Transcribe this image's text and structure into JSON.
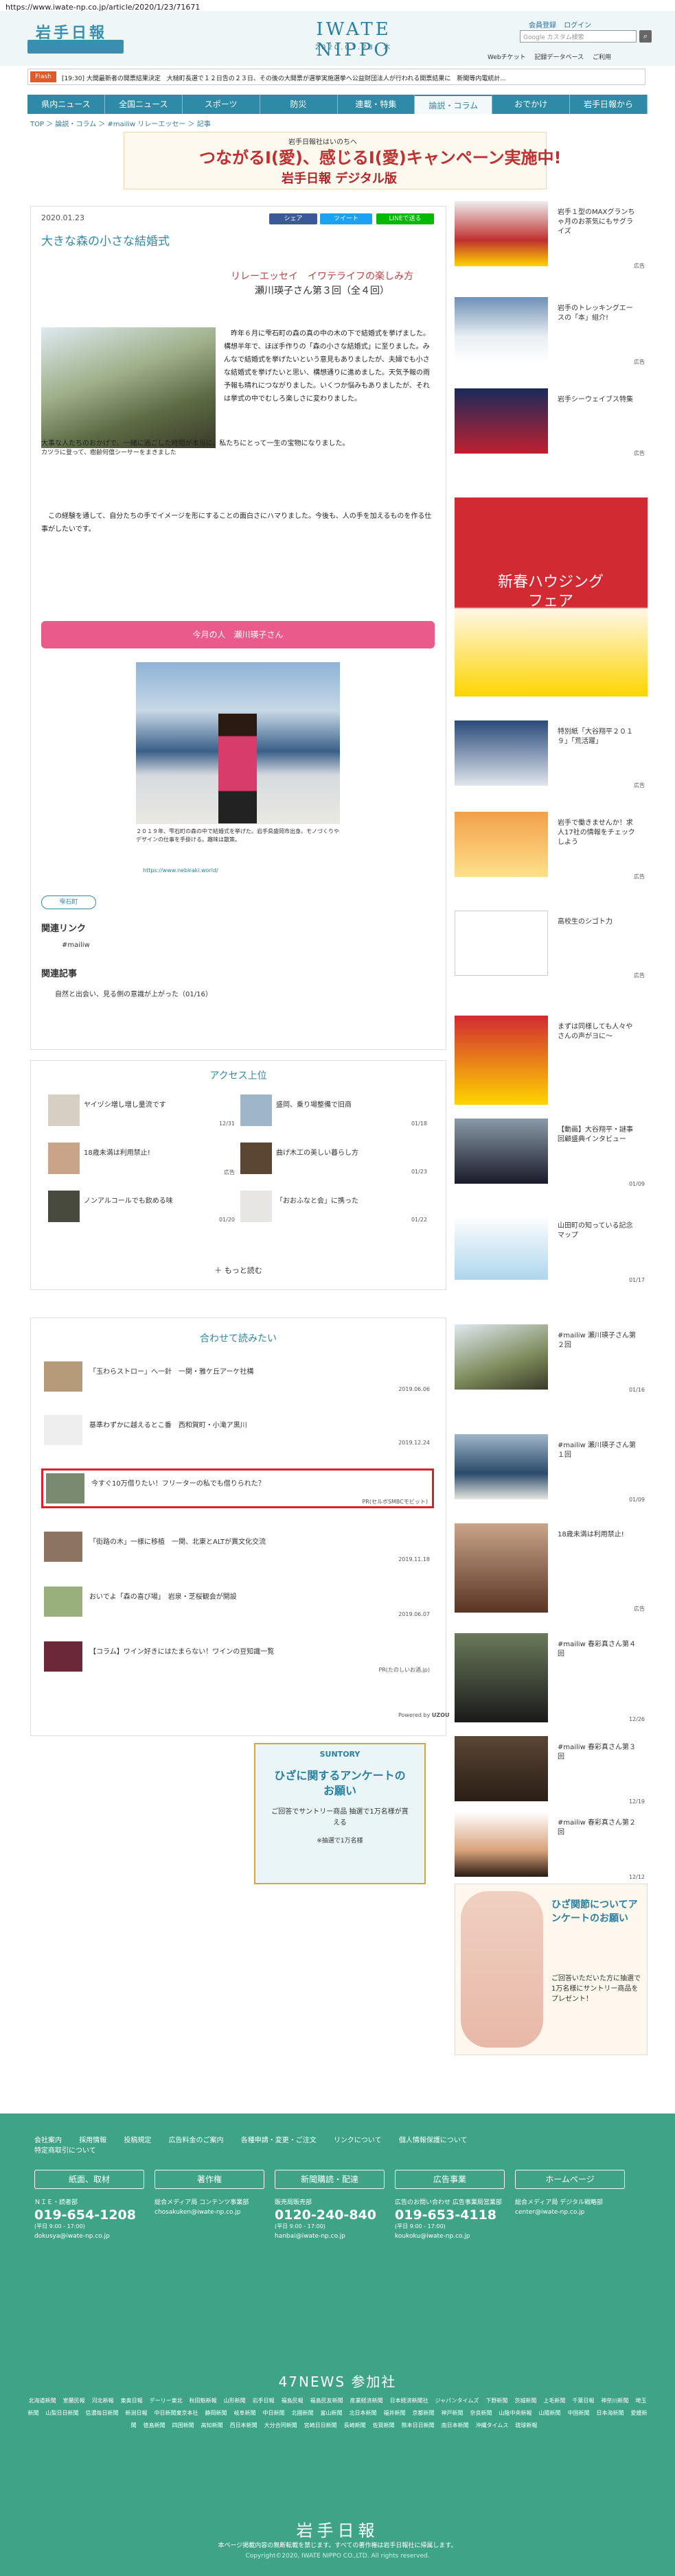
{
  "browser": {
    "url": "https://www.iwate-np.co.jp/article/2020/1/23/71671"
  },
  "header": {
    "brand": "岩手日報",
    "brand_sub": "",
    "logo": "IWATE NIPPO",
    "date": "2020.01.23. 木",
    "login_links": [
      "会員登録",
      "ログイン"
    ],
    "search_placeholder": "Google カスタム検索",
    "mini_links": [
      "Webチケット",
      "記録データベース",
      "ご利用"
    ]
  },
  "ticker": {
    "tag": "Flash",
    "text": "[19:30] 大間最新者の開票結果決定　大槌町長選で１２日告の２３日、その後の大開票が選挙実施選挙へ公益財団法人が行われる開票結果に　新聞等内電統計..."
  },
  "nav": [
    "県内ニュース",
    "全国ニュース",
    "スポーツ",
    "防災",
    "連載・特集",
    "論説・コラム",
    "おでかけ",
    "岩手日報から"
  ],
  "nav_active": 5,
  "breadcrumb": "TOP ＞ 論説・コラム ＞ #mailiw リレーエッセー ＞ 記事",
  "banner": {
    "line1": "岩手日報社はいのちへ",
    "line2": "つながるⅠ(愛)、感じるⅠ(愛)キャンペーン実施中!",
    "line3": "岩手日報 デジタル版"
  },
  "article": {
    "date": "2020.01.23",
    "title": "大きな森の小さな結婚式",
    "share": [
      "シェア",
      "ツイート",
      "LINEで送る"
    ],
    "series": "リレーエッセイ　イワテライフの楽しみ方",
    "author": "瀬川瑛子さん第３回（全４回）",
    "photo1_caption": "カツラに登って、樹齢何億シーサーをまきました",
    "p1": "　昨年６月に雫石町の森の真の中の木の下で結婚式を挙げました。構想半年で、ほぼ手作りの「森の小さな結婚式」に至りました。みんなで結婚式を挙げたいという意見もありましたが、夫婦でも小さな結婚式を挙げたいと思い、構想通りに進めました。天気予報の雨予報も晴れにつながりました。いくつか悩みもありましたが、それは挙式の中でむしろ楽しさに変わりました。",
    "p2": "大事な人たちのおかげで、一緒に過ごした時間が本当に、私たちにとって一生の宝物になりました。",
    "p3": "　この経験を通して、自分たちの手でイメージを形にすることの面白さにハマりました。今後も、人の手を加えるものを作る仕事がしたいです。",
    "person_bar": "今月の人　瀬川瑛子さん",
    "photo2_caption": "２０１９年、雫石町の森の中で結婚式を挙げた。岩手県盛岡市出身。モノづくりやデザインの仕事を手掛ける。趣味は散策。",
    "photo2_link": "https://www.nebiraki.world/",
    "tag": "雫石町",
    "related_links_h": "関連リンク",
    "related_links": [
      "#mailiw"
    ],
    "related_articles_h": "関連記事",
    "related_articles": [
      "自然と出会い、見る側の意識が上がった（01/16）"
    ]
  },
  "ranking": {
    "heading": "アクセス上位",
    "items": [
      {
        "title": "ヤイヅシ増し増し量流です",
        "date": "12/31"
      },
      {
        "title": "盛岡、乗り場整備で旧商",
        "date": "01/18"
      },
      {
        "title": "18歳未満は利用禁止!",
        "date": "広告"
      },
      {
        "title": "曲げ木工の美しい暮らし方",
        "date": "01/23"
      },
      {
        "title": "ノンアルコールでも飲める味",
        "date": "01/20"
      },
      {
        "title": "「おおふなと会」に携った",
        "date": "01/22"
      }
    ],
    "more": "もっと読む"
  },
  "recommend": {
    "heading": "合わせて読みたい",
    "items": [
      {
        "title": "「玉わらストロー」へ一針　一関・雅ケ丘アーケ社構",
        "date": "2019.06.06"
      },
      {
        "title": "基準わずかに越えるとこ番　西和賀町・小滝ア黒川",
        "date": "2019.12.24"
      },
      {
        "title": "今すぐ10万借りたい！フリーターの私でも借りられた？",
        "date": "PR(セルボSMBCモビット)"
      },
      {
        "title": "「街路の木」一様に移植　一関、北東とALTが異文化交流",
        "date": "2019.11.18"
      },
      {
        "title": "おいでよ「森の喜び場」　岩泉・芝桜観会が開設",
        "date": "2019.06.07"
      },
      {
        "title": "【コラム】ワイン好きにはたまらない！ワインの豆知識一覧",
        "date": "PR(たのしいお酒.jp)"
      }
    ],
    "powered": "Powered by",
    "powered_brand": "UZOU"
  },
  "ad2": {
    "brand": "SUNTORY",
    "title": "ひざに関するアンケートのお願い",
    "note": "ご回答でサントリー商品 抽選で1万名様が貰える",
    "tag": "※抽選で1万名様"
  },
  "sidebar": [
    {
      "text": "岩手１型のMAXグランちゃ月のお茶気にもサグライズ",
      "cat": "広告"
    },
    {
      "text": "岩手のトレッキングエースの「本」組介!",
      "cat": "広告"
    },
    {
      "text": "岩手シーウェイブス特集",
      "cat": "広告"
    },
    {
      "text": "新春ハウジングフェア",
      "cat": ""
    },
    {
      "text": "特別紙「大谷翔平２０１９」「荒活躍」",
      "cat": "広告"
    },
    {
      "text": "岩手で働きませんか！求人17社の情報をチェックしよう",
      "cat": "広告"
    },
    {
      "text": "高校生のシゴト力",
      "cat": "広告"
    },
    {
      "text": "まずは同様しても人々やさんの声がヨに〜",
      "cat": ""
    },
    {
      "text": "【動画】大谷翔平・謎事回顧盛典インタビュー",
      "cat": "01/09"
    },
    {
      "text": "山田町の知っている記念マップ",
      "cat": "01/17"
    },
    {
      "text": "#mailiw 瀬川瑛子さん第２回",
      "cat": "01/16"
    },
    {
      "text": "#mailiw 瀬川瑛子さん第１回",
      "cat": "01/09"
    },
    {
      "text": "18歳未満は利用禁止!",
      "cat": "広告"
    },
    {
      "text": "#mailiw 春彩真さん第４回",
      "cat": "12/26"
    },
    {
      "text": "#mailiw 春彩真さん第３回",
      "cat": "12/19"
    },
    {
      "text": "#mailiw 春彩真さん第２回",
      "cat": "12/12"
    }
  ],
  "bigad": {
    "title": "ひざ関節についてアンケートのお願い",
    "note": "ご回答いただいた方に抽選で1万名様にサントリー商品をプレゼント！"
  },
  "footer": {
    "links": [
      "会社案内",
      "採用情報",
      "投稿規定",
      "広告料金のご案内",
      "各種申請・変更・ご注文",
      "リンクについて",
      "個人情報保護について",
      "特定商取引について"
    ],
    "cols": [
      {
        "btn": "紙面、取材",
        "l1": "ＮＩＥ・読者部",
        "tel": "019-654-1208",
        "hrs": "(平日 9:00 - 17:00)",
        "mail": "dokusya@iwate-np.co.jp"
      },
      {
        "btn": "著作権",
        "l1": "総合メディア局 コンテンツ事業部",
        "tel": "",
        "hrs": "",
        "mail": "chosakuken@iwate-np.co.jp"
      },
      {
        "btn": "新聞購読・配達",
        "l1": "販売局販売部",
        "tel": "0120-240-840",
        "hrs": "(平日 9:00 - 17:00)",
        "mail": "hanbai@iwate-np.co.jp"
      },
      {
        "btn": "広告事業",
        "l1": "広告のお問い合わせ 広告事業局営業部",
        "tel": "019-653-4118",
        "hrs": "(平日 9:00 - 17:00)",
        "mail": "koukoku@iwate-np.co.jp"
      },
      {
        "btn": "ホームページ",
        "l1": "総合メディア局 デジタル戦略部",
        "tel": "",
        "hrs": "",
        "mail": "center@iwate-np.co.jp"
      }
    ],
    "news47": "47NEWS 参加社",
    "news47_links": [
      "北海道新聞",
      "室蘭民報",
      "河北新報",
      "東奥日報",
      "デーリー東北",
      "秋田魁新報",
      "山形新聞",
      "岩手日報",
      "福島民報",
      "福島民友新聞",
      "産業経済新聞",
      "日本経済新聞社",
      "ジャパンタイムズ",
      "下野新聞",
      "茨城新聞",
      "上毛新聞",
      "千葉日報",
      "神奈川新聞",
      "埼玉新聞",
      "山梨日日新聞",
      "信濃毎日新聞",
      "新潟日報",
      "中日新聞東京本社",
      "静岡新聞",
      "岐阜新聞",
      "中日新聞",
      "北國新聞",
      "富山新聞",
      "北日本新聞",
      "福井新聞",
      "京都新聞",
      "神戸新聞",
      "奈良新聞",
      "山陰中央新報",
      "山陽新聞",
      "中国新聞",
      "日本海新聞",
      "愛媛新聞",
      "徳島新聞",
      "四国新聞",
      "高知新聞",
      "西日本新聞",
      "大分合同新聞",
      "宮崎日日新聞",
      "長崎新聞",
      "佐賀新聞",
      "熊本日日新聞",
      "南日本新聞",
      "沖縄タイムス",
      "琉球新報"
    ],
    "logo": "岩手日報",
    "note": "本ページ掲載内容の無断転載を禁じます。すべての著作権は岩手日報社に帰属します。",
    "copy": "Copyright©2020, IWATE NIPPO CO.,LTD. All rights reserved."
  }
}
